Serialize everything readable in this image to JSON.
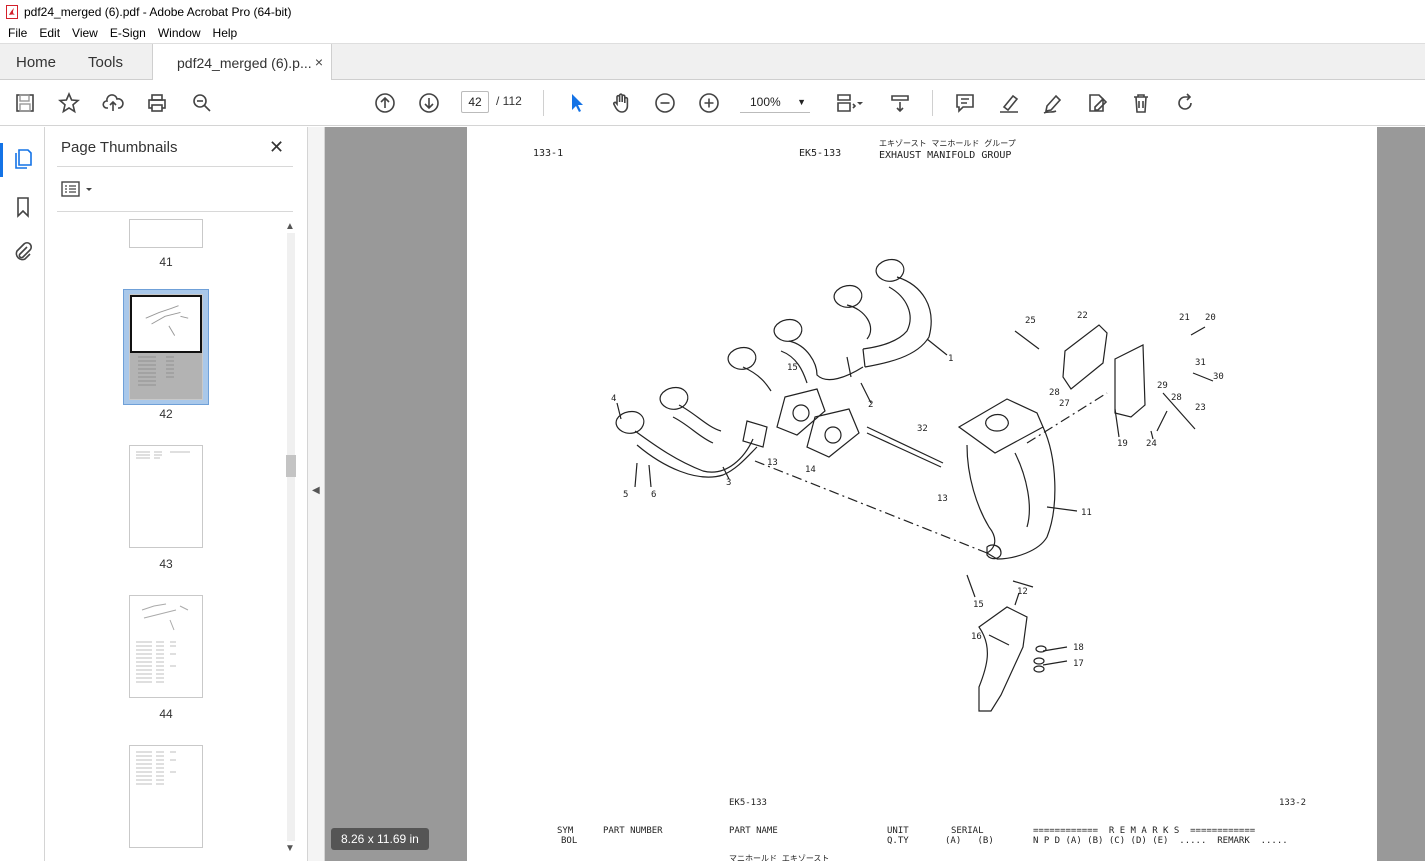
{
  "window": {
    "title": "pdf24_merged (6).pdf - Adobe Acrobat Pro (64-bit)"
  },
  "menu": [
    "File",
    "Edit",
    "View",
    "E-Sign",
    "Window",
    "Help"
  ],
  "tabs": {
    "home": "Home",
    "tools": "Tools",
    "document": "pdf24_merged (6).p...",
    "close": "×"
  },
  "toolbar": {
    "current_page": "42",
    "page_total": "/  112",
    "zoom": "100%",
    "icons": [
      "save-icon",
      "bookmark-star-icon",
      "upload-icon",
      "print-icon",
      "zoom-search-icon",
      "page-up-icon",
      "page-down-icon",
      "select-arrow-icon",
      "hand-icon",
      "zoom-out-icon",
      "zoom-in-icon",
      "fit-page-icon",
      "scroll-mode-icon",
      "comment-icon",
      "highlight-icon",
      "draw-icon",
      "edit-icon",
      "delete-icon",
      "rotate-icon"
    ]
  },
  "panel": {
    "title": "Page Thumbnails",
    "close": "✕",
    "thumbnails": [
      {
        "label": "41"
      },
      {
        "label": "42",
        "selected": true
      },
      {
        "label": "43"
      },
      {
        "label": "44"
      },
      {
        "label": ""
      }
    ]
  },
  "page": {
    "header_left": "133-1",
    "header_code": "EK5-133",
    "header_jp": "エキゾースト マニホールド グループ",
    "header_en": "EXHAUST MANIFOLD GROUP",
    "footer_code": "EK5-133",
    "footer_right": "133-2",
    "table_headers": {
      "sym": "SYM",
      "bol": "BOL",
      "part_number": "PART NUMBER",
      "part_name": "PART NAME",
      "unit": "UNIT",
      "qty": "Q.TY",
      "serial": "SERIAL",
      "serial_cols": "(A)   (B)",
      "remarks": "============  R E M A R K S  ============",
      "remarks_cols": "N P D (A) (B) (C) (D) (E)  .....  REMARK  .....",
      "first_row": "マニホールド エキゾースト"
    },
    "callouts": [
      "1",
      "2",
      "3",
      "4",
      "5",
      "6",
      "11",
      "12",
      "13",
      "13",
      "14",
      "15",
      "15",
      "16",
      "17",
      "18",
      "19",
      "20",
      "21",
      "22",
      "23",
      "24",
      "25",
      "27",
      "28",
      "28",
      "29",
      "30",
      "31",
      "32"
    ]
  },
  "status": {
    "page_size": "8.26 x 11.69 in"
  }
}
